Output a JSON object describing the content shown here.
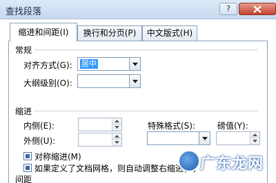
{
  "window": {
    "title": "查找段落"
  },
  "tabs": [
    {
      "label": "缩进和间距(I)"
    },
    {
      "label": "换行和分页(P)"
    },
    {
      "label": "中文版式(H)"
    }
  ],
  "general": {
    "heading": "常规",
    "alignment_label": "对齐方式(G):",
    "alignment_value": "居中",
    "outline_label": "大纲级别(O):",
    "outline_value": ""
  },
  "indent": {
    "heading": "缩进",
    "inside_label": "内侧(E):",
    "outside_label": "外侧(U):",
    "special_label": "特殊格式(S):",
    "amount_label": "磅值(Y):",
    "mirror_label": "对称缩进(M)",
    "grid_label": "如果定义了文档网格，则自动调整右缩进(D)"
  },
  "spacing": {
    "heading": "间距"
  },
  "watermark": {
    "text": "广东龙网"
  }
}
